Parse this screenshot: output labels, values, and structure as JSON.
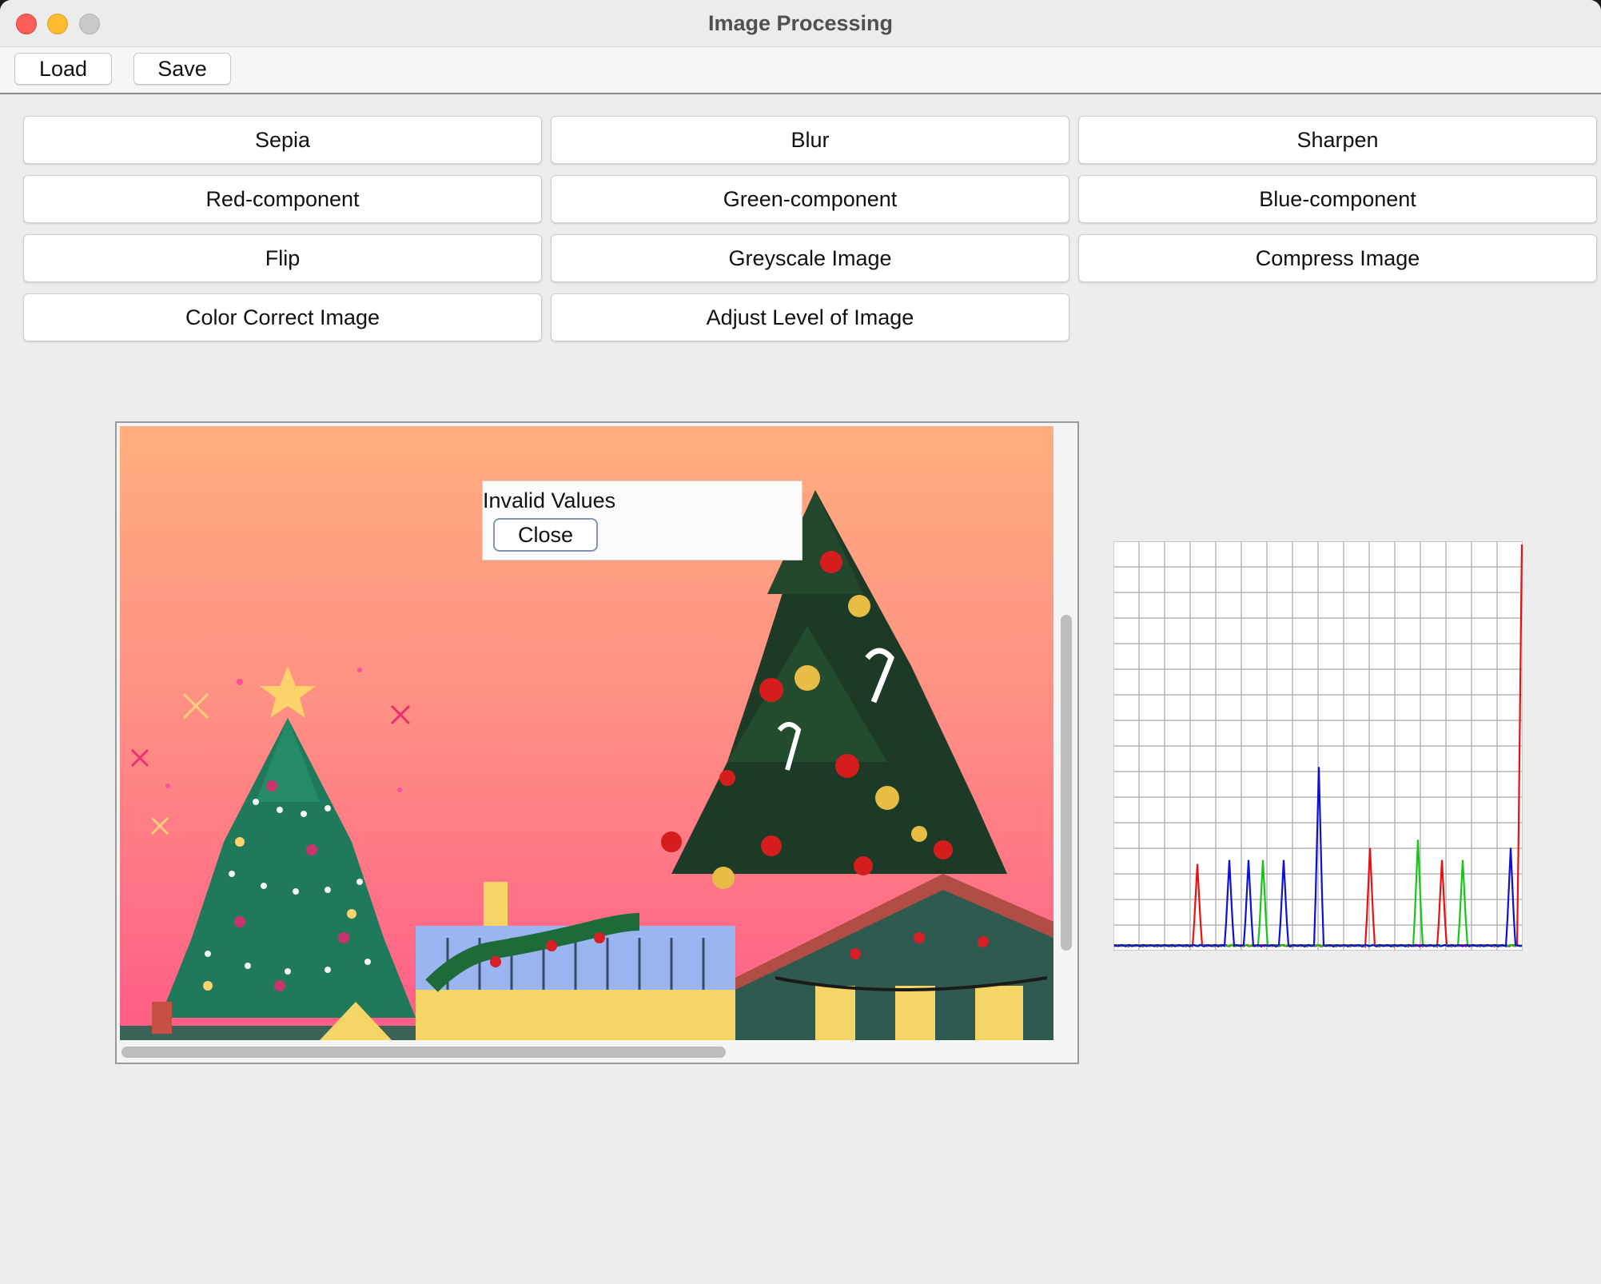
{
  "window": {
    "title": "Image Processing"
  },
  "menubar": {
    "load_label": "Load",
    "save_label": "Save"
  },
  "filters": {
    "sepia": "Sepia",
    "blur": "Blur",
    "sharpen": "Sharpen",
    "red_component": "Red-component",
    "green_component": "Green-component",
    "blue_component": "Blue-component",
    "flip": "Flip",
    "greyscale": "Greyscale Image",
    "compress": "Compress Image",
    "color_correct": "Color Correct Image",
    "adjust_level": "Adjust Level of Image"
  },
  "dialog": {
    "message": "Invalid Values",
    "close_label": "Close"
  },
  "histogram": {
    "chart_data": {
      "type": "line",
      "xlim": [
        0,
        255
      ],
      "grid": true,
      "series": [
        {
          "color": "#e81010",
          "peaks": [
            [
              52,
              0.21
            ],
            [
              160,
              0.25
            ],
            [
              205,
              0.22
            ],
            [
              255,
              1.0
            ]
          ]
        },
        {
          "color": "#18c418",
          "peaks": [
            [
              93,
              0.22
            ],
            [
              190,
              0.27
            ],
            [
              218,
              0.22
            ]
          ]
        },
        {
          "color": "#1010d0",
          "peaks": [
            [
              72,
              0.22
            ],
            [
              84,
              0.22
            ],
            [
              106,
              0.22
            ],
            [
              128,
              0.45
            ],
            [
              248,
              0.25
            ]
          ]
        }
      ]
    }
  },
  "colors": {
    "window_bg": "#ededed",
    "dialog_button_border": "#8392b3",
    "close_light": "#ff5f57",
    "minimize_light": "#febc2e"
  }
}
